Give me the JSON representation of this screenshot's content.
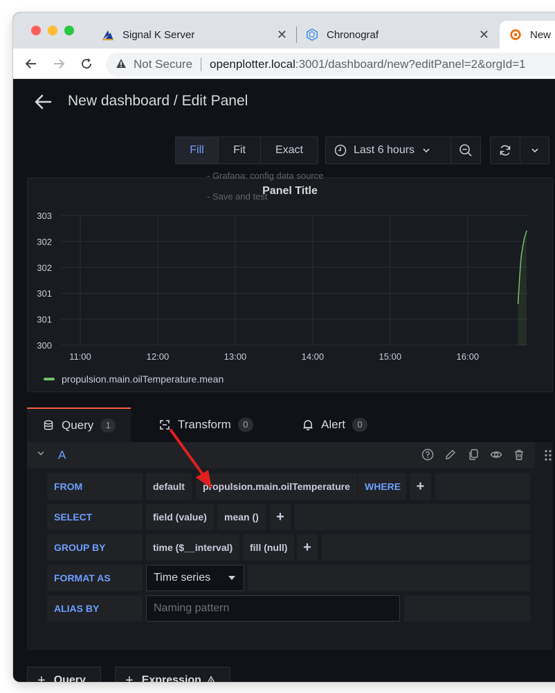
{
  "browser": {
    "tabs": [
      {
        "title": "Signal K Server",
        "icon": "signalk-icon"
      },
      {
        "title": "Chronograf",
        "icon": "chronograf-icon"
      },
      {
        "title": "New",
        "icon": "grafana-icon"
      }
    ],
    "close_glyph": "✕",
    "security_label": "Not Secure",
    "url_host": "openplotter.local",
    "url_rest": ":3001/dashboard/new?editPanel=2&orgId=1"
  },
  "header": {
    "title": "New dashboard / Edit Panel"
  },
  "toolbar": {
    "view_modes": [
      "Fill",
      "Fit",
      "Exact"
    ],
    "active_view_mode": "Fill",
    "time_range": "Last 6 hours",
    "tooltip_lines": [
      "- Grafana: config data source",
      "- Save and test"
    ]
  },
  "panel": {
    "title": "Panel Title"
  },
  "chart_data": {
    "type": "line",
    "title": "Panel Title",
    "x_tick_labels": [
      "11:00",
      "12:00",
      "13:00",
      "14:00",
      "15:00",
      "16:00"
    ],
    "y_tick_labels": [
      "303",
      "302",
      "302",
      "301",
      "301",
      "300"
    ],
    "ylim": [
      300,
      302.5
    ],
    "grid": true,
    "legend_position": "bottom-left",
    "series": [
      {
        "name": "propulsion.main.oilTemperature.mean",
        "color": "#73bf69",
        "x_hours": [
          16.65,
          16.67,
          16.69,
          16.71,
          16.73,
          16.76
        ],
        "values": [
          300.8,
          301.3,
          301.7,
          301.9,
          302.05,
          302.2
        ]
      }
    ]
  },
  "query_tabs": [
    {
      "label": "Query",
      "count": "1"
    },
    {
      "label": "Transform",
      "count": "0"
    },
    {
      "label": "Alert",
      "count": "0"
    }
  ],
  "query": {
    "name": "A",
    "from_label": "FROM",
    "from_policy": "default",
    "measurement": "propulsion.main.oilTemperature",
    "where_label": "WHERE",
    "select_label": "SELECT",
    "select_field": "field (value)",
    "select_agg": "mean ()",
    "group_by_label": "GROUP BY",
    "group_time": "time ($__interval)",
    "group_fill": "fill (null)",
    "format_as_label": "FORMAT AS",
    "format_value": "Time series",
    "alias_label": "ALIAS BY",
    "alias_placeholder": "Naming pattern",
    "plus": "+"
  },
  "bottom_buttons": {
    "add_query": "Query",
    "add_expression": "Expression"
  },
  "annotation_color": "#e02020"
}
